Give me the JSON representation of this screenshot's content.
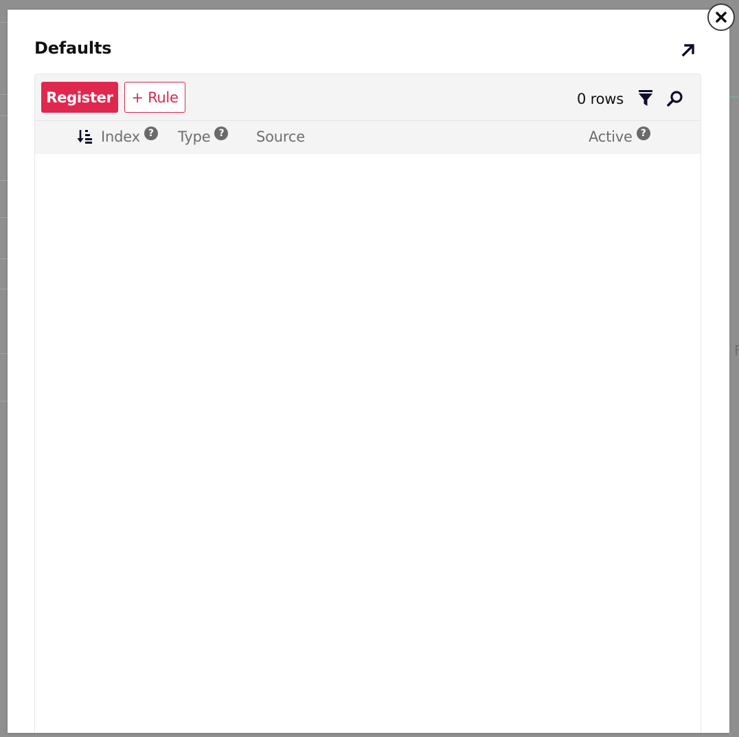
{
  "modal": {
    "title": "Defaults"
  },
  "toolbar": {
    "register_label": "Register",
    "rule_label": "+ Rule",
    "rows_count": "0 rows"
  },
  "table": {
    "columns": [
      {
        "label": "Index",
        "has_help": true,
        "sorted": true
      },
      {
        "label": "Type",
        "has_help": true,
        "sorted": false
      },
      {
        "label": "Source",
        "has_help": false,
        "sorted": false
      },
      {
        "label": "Active",
        "has_help": true,
        "sorted": false
      }
    ],
    "rows": []
  },
  "icons": {
    "help_glyph": "?",
    "background_fragment": "F"
  },
  "colors": {
    "accent": "#e0284f",
    "text": "#111111",
    "muted": "#6e6e6e",
    "toolbar_bg": "#f4f4f4"
  }
}
